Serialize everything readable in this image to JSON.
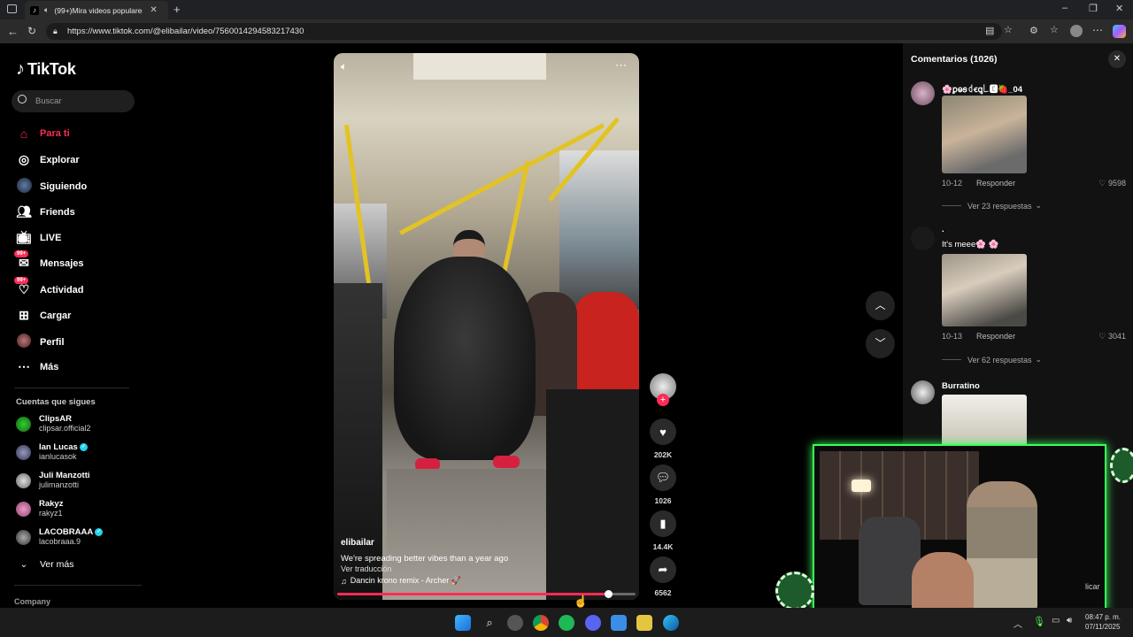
{
  "browser": {
    "tab_title": "(99+)Mira videos populares",
    "url": "https://www.tiktok.com/@elibailar/video/7560014294583217430",
    "new_tab": "+"
  },
  "sidebar": {
    "logo": "TikTok",
    "search_placeholder": "Buscar",
    "nav": [
      {
        "label": "Para ti",
        "icon": "home-icon"
      },
      {
        "label": "Explorar",
        "icon": "compass-icon"
      },
      {
        "label": "Siguiendo",
        "icon": "following-icon"
      },
      {
        "label": "Friends",
        "icon": "friends-icon"
      },
      {
        "label": "LIVE",
        "icon": "live-icon"
      },
      {
        "label": "Mensajes",
        "icon": "messages-icon",
        "badge": "99+"
      },
      {
        "label": "Actividad",
        "icon": "activity-icon",
        "badge": "99+"
      },
      {
        "label": "Cargar",
        "icon": "upload-icon"
      },
      {
        "label": "Perfil",
        "icon": "profile-icon"
      },
      {
        "label": "Más",
        "icon": "more-icon"
      }
    ],
    "following_heading": "Cuentas que sigues",
    "accounts": [
      {
        "name": "ClipsAR",
        "handle": "clipsar.official2",
        "verified": false
      },
      {
        "name": "Ian Lucas",
        "handle": "ianlucasok",
        "verified": true
      },
      {
        "name": "Juli Manzotti",
        "handle": "julimanzotti",
        "verified": false
      },
      {
        "name": "Rakyz",
        "handle": "rakyz1",
        "verified": false
      },
      {
        "name": "LACOBRAAA",
        "handle": "lacobraaa.9",
        "verified": true
      }
    ],
    "see_more": "Ver más",
    "company": "Company"
  },
  "video": {
    "author": "elibailar",
    "caption": "We're spreading better vibes than a year ago",
    "translate": "Ver traducción",
    "music": "Dancin krono remix - Archer 🚀",
    "progress": 0.91
  },
  "actions": {
    "likes": "202K",
    "comments": "1026",
    "saves": "14.4K",
    "shares": "6562"
  },
  "comments": {
    "title": "Comentarios (1026)",
    "items": [
      {
        "user": "🌸ꝑⱺꞩ꒯ꞓꝗ꒒🅴🍓_04",
        "date": "10-12",
        "reply": "Responder",
        "likes": "9598",
        "replies": "Ver 23 respuestas"
      },
      {
        "user": ".",
        "text": "It's meee🌸 🌸",
        "date": "10-13",
        "reply": "Responder",
        "likes": "3041",
        "replies": "Ver 62 respuestas"
      },
      {
        "user": "Burratino"
      }
    ]
  },
  "webcam": {
    "overlay_text": "licar"
  },
  "taskbar": {
    "time": "08:47 p. m.",
    "date": "07/11/2025"
  },
  "colors": {
    "accent": "#fe2c55",
    "verified": "#20d5ec",
    "webcam_border": "#39ff5a"
  }
}
